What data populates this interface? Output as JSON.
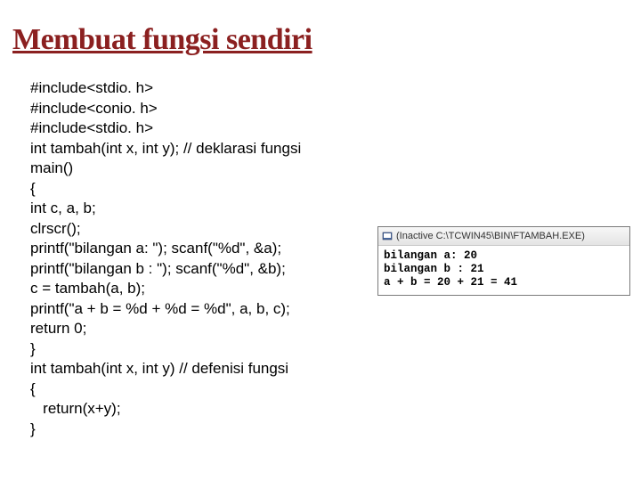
{
  "title": "Membuat fungsi sendiri",
  "code": {
    "l1": "#include<stdio. h>",
    "l2": "#include<conio. h>",
    "l3": "#include<stdio. h>",
    "l4": "int tambah(int x, int y); // deklarasi fungsi",
    "l5": "main()",
    "l6": "{",
    "l7": "int c, a, b;",
    "l8": "clrscr();",
    "l9": "printf(\"bilangan a: \"); scanf(\"%d\", &a);",
    "l10": "printf(\"bilangan b : \"); scanf(\"%d\", &b);",
    "l11": "c = tambah(a, b);",
    "l12": "printf(\"a + b = %d + %d = %d\", a, b, c);",
    "l13": "return 0;",
    "l14": "}",
    "l15": "int tambah(int x, int y) // defenisi fungsi",
    "l16": "{",
    "l17": "   return(x+y);",
    "l18": "}"
  },
  "terminal": {
    "caption": "(Inactive C:\\TCWIN45\\BIN\\FTAMBAH.EXE)",
    "line1": "bilangan a: 20",
    "line2": "bilangan b : 21",
    "line3": "a + b = 20 + 21 = 41"
  }
}
